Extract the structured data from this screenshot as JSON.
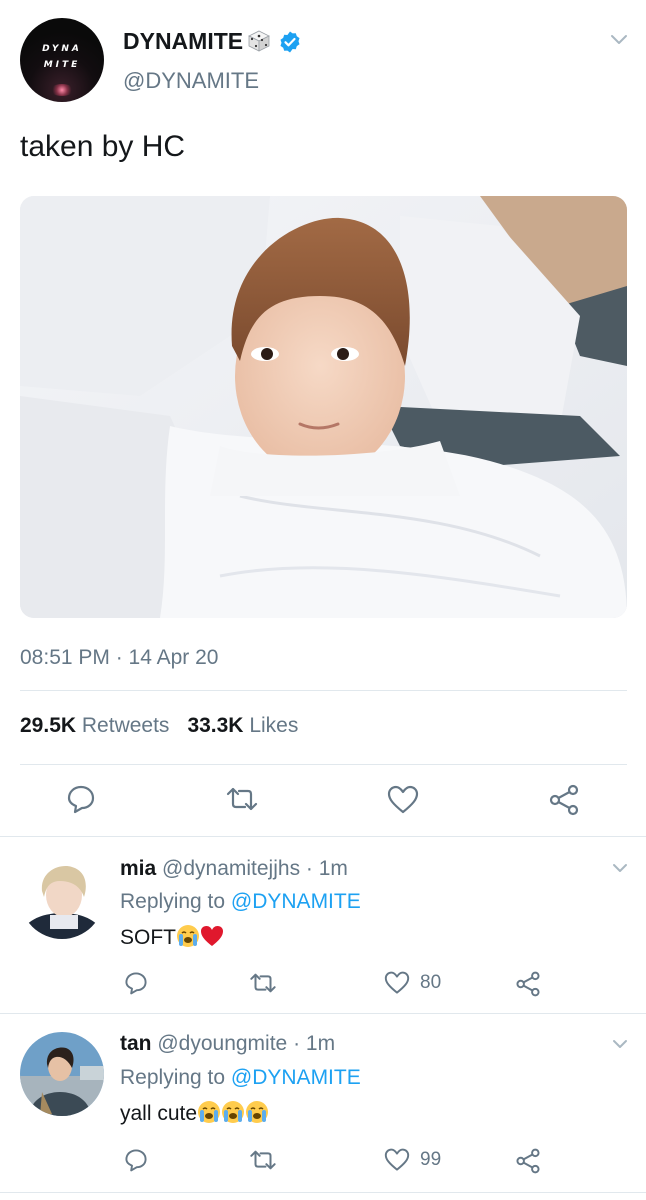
{
  "tweet": {
    "display_name": "DYNAMITE",
    "handle": "@DYNAMITE",
    "avatar_logo_line1": "DYNA",
    "avatar_logo_line2": "MITE",
    "text": "taken by HC",
    "timestamp": "08:51 PM · 14 Apr 20",
    "retweets_count": "29.5K",
    "retweets_label": "Retweets",
    "likes_count": "33.3K",
    "likes_label": "Likes",
    "verified": true,
    "emoji": "dice-icon"
  },
  "replies": [
    {
      "name": "mia",
      "handle": "@dynamitejjhs",
      "time": "· 1m",
      "replying_prefix": "Replying to",
      "replying_to": "@DYNAMITE",
      "text": "SOFT",
      "emojis": [
        "crying-face-icon",
        "red-heart-icon"
      ],
      "like_count": "80"
    },
    {
      "name": "tan",
      "handle": "@dyoungmite",
      "time": "· 1m",
      "replying_prefix": "Replying to",
      "replying_to": "@DYNAMITE",
      "text": "yall cute",
      "emojis": [
        "crying-face-icon",
        "crying-face-icon",
        "crying-face-icon"
      ],
      "like_count": "99"
    }
  ],
  "colors": {
    "link_blue": "#1da1f2",
    "secondary_gray": "#657786",
    "text_dark": "#14171a",
    "divider": "#e1e8ed"
  }
}
